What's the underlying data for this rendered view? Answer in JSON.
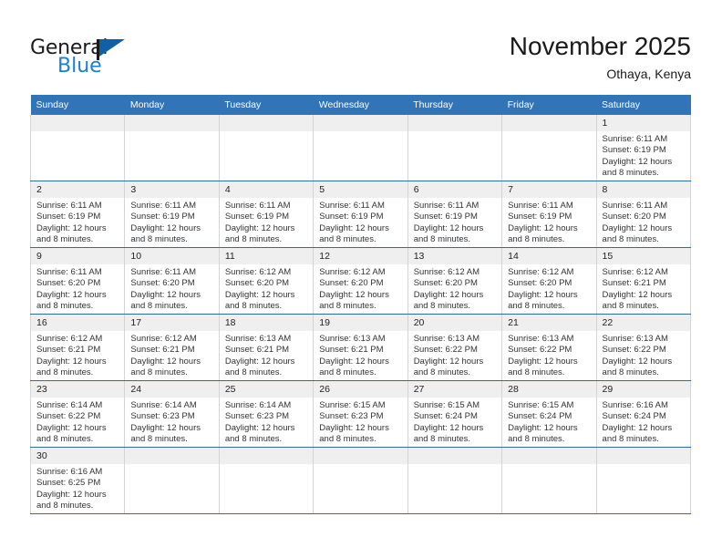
{
  "brand": {
    "name_top": "General",
    "name_bottom": "Blue",
    "flag_icon": "blue-flag-icon",
    "colors": {
      "general_text": "#1a1a1a",
      "blue_text": "#1b7fd4",
      "flag": "#1060a8"
    }
  },
  "header": {
    "month_title": "November 2025",
    "location": "Othaya, Kenya"
  },
  "theme": {
    "header_row_bg": "#3274b8",
    "header_row_text": "#ffffff",
    "day_number_bg": "#efefef",
    "cell_border": "#d4d4d4",
    "row_divider": "#2d6ca8"
  },
  "calendar": {
    "weekday_headers": [
      "Sunday",
      "Monday",
      "Tuesday",
      "Wednesday",
      "Thursday",
      "Friday",
      "Saturday"
    ],
    "weeks": [
      [
        {
          "day": "",
          "empty": true
        },
        {
          "day": "",
          "empty": true
        },
        {
          "day": "",
          "empty": true
        },
        {
          "day": "",
          "empty": true
        },
        {
          "day": "",
          "empty": true
        },
        {
          "day": "",
          "empty": true
        },
        {
          "day": "1",
          "sunrise": "Sunrise: 6:11 AM",
          "sunset": "Sunset: 6:19 PM",
          "daylight_1": "Daylight: 12 hours",
          "daylight_2": "and 8 minutes."
        }
      ],
      [
        {
          "day": "2",
          "sunrise": "Sunrise: 6:11 AM",
          "sunset": "Sunset: 6:19 PM",
          "daylight_1": "Daylight: 12 hours",
          "daylight_2": "and 8 minutes."
        },
        {
          "day": "3",
          "sunrise": "Sunrise: 6:11 AM",
          "sunset": "Sunset: 6:19 PM",
          "daylight_1": "Daylight: 12 hours",
          "daylight_2": "and 8 minutes."
        },
        {
          "day": "4",
          "sunrise": "Sunrise: 6:11 AM",
          "sunset": "Sunset: 6:19 PM",
          "daylight_1": "Daylight: 12 hours",
          "daylight_2": "and 8 minutes."
        },
        {
          "day": "5",
          "sunrise": "Sunrise: 6:11 AM",
          "sunset": "Sunset: 6:19 PM",
          "daylight_1": "Daylight: 12 hours",
          "daylight_2": "and 8 minutes."
        },
        {
          "day": "6",
          "sunrise": "Sunrise: 6:11 AM",
          "sunset": "Sunset: 6:19 PM",
          "daylight_1": "Daylight: 12 hours",
          "daylight_2": "and 8 minutes."
        },
        {
          "day": "7",
          "sunrise": "Sunrise: 6:11 AM",
          "sunset": "Sunset: 6:19 PM",
          "daylight_1": "Daylight: 12 hours",
          "daylight_2": "and 8 minutes."
        },
        {
          "day": "8",
          "sunrise": "Sunrise: 6:11 AM",
          "sunset": "Sunset: 6:20 PM",
          "daylight_1": "Daylight: 12 hours",
          "daylight_2": "and 8 minutes."
        }
      ],
      [
        {
          "day": "9",
          "sunrise": "Sunrise: 6:11 AM",
          "sunset": "Sunset: 6:20 PM",
          "daylight_1": "Daylight: 12 hours",
          "daylight_2": "and 8 minutes."
        },
        {
          "day": "10",
          "sunrise": "Sunrise: 6:11 AM",
          "sunset": "Sunset: 6:20 PM",
          "daylight_1": "Daylight: 12 hours",
          "daylight_2": "and 8 minutes."
        },
        {
          "day": "11",
          "sunrise": "Sunrise: 6:12 AM",
          "sunset": "Sunset: 6:20 PM",
          "daylight_1": "Daylight: 12 hours",
          "daylight_2": "and 8 minutes."
        },
        {
          "day": "12",
          "sunrise": "Sunrise: 6:12 AM",
          "sunset": "Sunset: 6:20 PM",
          "daylight_1": "Daylight: 12 hours",
          "daylight_2": "and 8 minutes."
        },
        {
          "day": "13",
          "sunrise": "Sunrise: 6:12 AM",
          "sunset": "Sunset: 6:20 PM",
          "daylight_1": "Daylight: 12 hours",
          "daylight_2": "and 8 minutes."
        },
        {
          "day": "14",
          "sunrise": "Sunrise: 6:12 AM",
          "sunset": "Sunset: 6:20 PM",
          "daylight_1": "Daylight: 12 hours",
          "daylight_2": "and 8 minutes."
        },
        {
          "day": "15",
          "sunrise": "Sunrise: 6:12 AM",
          "sunset": "Sunset: 6:21 PM",
          "daylight_1": "Daylight: 12 hours",
          "daylight_2": "and 8 minutes."
        }
      ],
      [
        {
          "day": "16",
          "sunrise": "Sunrise: 6:12 AM",
          "sunset": "Sunset: 6:21 PM",
          "daylight_1": "Daylight: 12 hours",
          "daylight_2": "and 8 minutes."
        },
        {
          "day": "17",
          "sunrise": "Sunrise: 6:12 AM",
          "sunset": "Sunset: 6:21 PM",
          "daylight_1": "Daylight: 12 hours",
          "daylight_2": "and 8 minutes."
        },
        {
          "day": "18",
          "sunrise": "Sunrise: 6:13 AM",
          "sunset": "Sunset: 6:21 PM",
          "daylight_1": "Daylight: 12 hours",
          "daylight_2": "and 8 minutes."
        },
        {
          "day": "19",
          "sunrise": "Sunrise: 6:13 AM",
          "sunset": "Sunset: 6:21 PM",
          "daylight_1": "Daylight: 12 hours",
          "daylight_2": "and 8 minutes."
        },
        {
          "day": "20",
          "sunrise": "Sunrise: 6:13 AM",
          "sunset": "Sunset: 6:22 PM",
          "daylight_1": "Daylight: 12 hours",
          "daylight_2": "and 8 minutes."
        },
        {
          "day": "21",
          "sunrise": "Sunrise: 6:13 AM",
          "sunset": "Sunset: 6:22 PM",
          "daylight_1": "Daylight: 12 hours",
          "daylight_2": "and 8 minutes."
        },
        {
          "day": "22",
          "sunrise": "Sunrise: 6:13 AM",
          "sunset": "Sunset: 6:22 PM",
          "daylight_1": "Daylight: 12 hours",
          "daylight_2": "and 8 minutes."
        }
      ],
      [
        {
          "day": "23",
          "sunrise": "Sunrise: 6:14 AM",
          "sunset": "Sunset: 6:22 PM",
          "daylight_1": "Daylight: 12 hours",
          "daylight_2": "and 8 minutes."
        },
        {
          "day": "24",
          "sunrise": "Sunrise: 6:14 AM",
          "sunset": "Sunset: 6:23 PM",
          "daylight_1": "Daylight: 12 hours",
          "daylight_2": "and 8 minutes."
        },
        {
          "day": "25",
          "sunrise": "Sunrise: 6:14 AM",
          "sunset": "Sunset: 6:23 PM",
          "daylight_1": "Daylight: 12 hours",
          "daylight_2": "and 8 minutes."
        },
        {
          "day": "26",
          "sunrise": "Sunrise: 6:15 AM",
          "sunset": "Sunset: 6:23 PM",
          "daylight_1": "Daylight: 12 hours",
          "daylight_2": "and 8 minutes."
        },
        {
          "day": "27",
          "sunrise": "Sunrise: 6:15 AM",
          "sunset": "Sunset: 6:24 PM",
          "daylight_1": "Daylight: 12 hours",
          "daylight_2": "and 8 minutes."
        },
        {
          "day": "28",
          "sunrise": "Sunrise: 6:15 AM",
          "sunset": "Sunset: 6:24 PM",
          "daylight_1": "Daylight: 12 hours",
          "daylight_2": "and 8 minutes."
        },
        {
          "day": "29",
          "sunrise": "Sunrise: 6:16 AM",
          "sunset": "Sunset: 6:24 PM",
          "daylight_1": "Daylight: 12 hours",
          "daylight_2": "and 8 minutes."
        }
      ],
      [
        {
          "day": "30",
          "sunrise": "Sunrise: 6:16 AM",
          "sunset": "Sunset: 6:25 PM",
          "daylight_1": "Daylight: 12 hours",
          "daylight_2": "and 8 minutes."
        },
        {
          "day": "",
          "empty": true
        },
        {
          "day": "",
          "empty": true
        },
        {
          "day": "",
          "empty": true
        },
        {
          "day": "",
          "empty": true
        },
        {
          "day": "",
          "empty": true
        },
        {
          "day": "",
          "empty": true
        }
      ]
    ]
  }
}
